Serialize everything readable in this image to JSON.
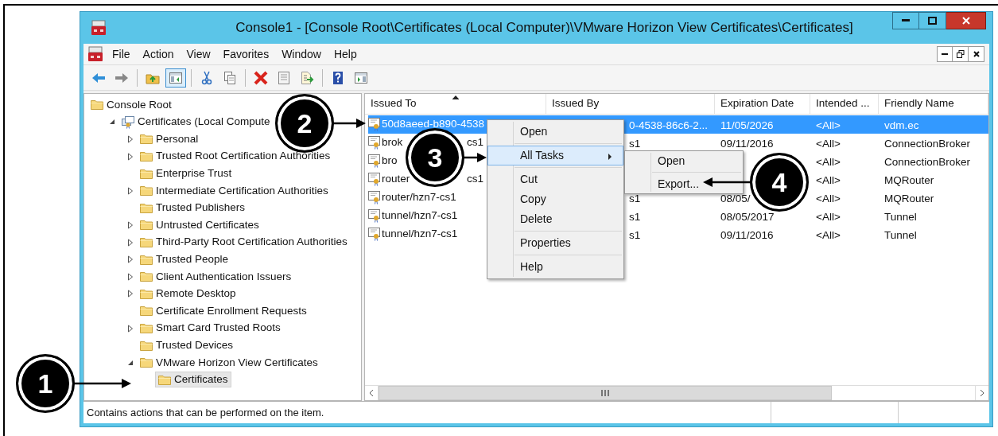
{
  "window": {
    "title": "Console1 - [Console Root\\Certificates (Local Computer)\\VMware Horizon View Certificates\\Certificates]"
  },
  "menu_bar": [
    "File",
    "Action",
    "View",
    "Favorites",
    "Window",
    "Help"
  ],
  "toolbar": [
    {
      "kind": "back",
      "selected": false
    },
    {
      "kind": "forward",
      "selected": false
    },
    {
      "kind": "folder-up",
      "selected": false
    },
    {
      "kind": "tree-toggle",
      "selected": true
    },
    {
      "kind": "cut",
      "selected": false
    },
    {
      "kind": "copy",
      "selected": false
    },
    {
      "kind": "delete",
      "selected": false
    },
    {
      "kind": "properties",
      "selected": false
    },
    {
      "kind": "export",
      "selected": false
    },
    {
      "kind": "help",
      "selected": false
    },
    {
      "kind": "action-pane",
      "selected": false
    }
  ],
  "tree": [
    {
      "label": "Console Root",
      "kind": "folder",
      "selected": false,
      "children": [
        {
          "label": "Certificates (Local Compute",
          "kind": "store",
          "expanded": true,
          "selected": false,
          "children": [
            {
              "label": "Personal",
              "kind": "folder",
              "expanded": false,
              "selected": false
            },
            {
              "label": "Trusted Root Certification Authorities",
              "kind": "folder",
              "expanded": false,
              "selected": false
            },
            {
              "label": "Enterprise Trust",
              "kind": "folder",
              "selected": false
            },
            {
              "label": "Intermediate Certification Authorities",
              "kind": "folder",
              "expanded": false,
              "selected": false
            },
            {
              "label": "Trusted Publishers",
              "kind": "folder",
              "selected": false
            },
            {
              "label": "Untrusted Certificates",
              "kind": "folder",
              "expanded": false,
              "selected": false
            },
            {
              "label": "Third-Party Root Certification Authorities",
              "kind": "folder",
              "expanded": false,
              "selected": false
            },
            {
              "label": "Trusted People",
              "kind": "folder",
              "expanded": false,
              "selected": false
            },
            {
              "label": "Client Authentication Issuers",
              "kind": "folder",
              "expanded": false,
              "selected": false
            },
            {
              "label": "Remote Desktop",
              "kind": "folder",
              "expanded": false,
              "selected": false
            },
            {
              "label": "Certificate Enrollment Requests",
              "kind": "folder",
              "selected": false
            },
            {
              "label": "Smart Card Trusted Roots",
              "kind": "folder",
              "expanded": false,
              "selected": false
            },
            {
              "label": "Trusted Devices",
              "kind": "folder",
              "selected": false
            },
            {
              "label": "VMware Horizon View Certificates",
              "kind": "folder",
              "expanded": true,
              "selected": false,
              "children": [
                {
                  "label": "Certificates",
                  "kind": "folder",
                  "selected": true
                }
              ]
            }
          ]
        }
      ]
    }
  ],
  "list": {
    "columns": [
      {
        "label": "Issued To",
        "sorted": true
      },
      {
        "label": "Issued By",
        "sorted": false
      },
      {
        "label": "Expiration Date",
        "sorted": false
      },
      {
        "label": "Intended ...",
        "sorted": false
      },
      {
        "label": "Friendly Name",
        "sorted": false
      }
    ],
    "rows": [
      {
        "selected": true,
        "issued_to": [
          "50d8aeed-b890-4538"
        ],
        "issued_by": "0-4538-86c6-2...",
        "expiration_date": "11/05/2026",
        "intended": "<All>",
        "friendly_name": "vdm.ec"
      },
      {
        "selected": false,
        "issued_to": [
          "brok",
          "cs1"
        ],
        "issued_by": "s1",
        "expiration_date": "09/11/2016",
        "intended": "<All>",
        "friendly_name": "ConnectionBroker"
      },
      {
        "selected": false,
        "issued_to": [
          "bro"
        ],
        "intended": "<All>",
        "friendly_name": "ConnectionBroker"
      },
      {
        "selected": false,
        "issued_to": [
          "router",
          "cs1"
        ],
        "intended": "<All>",
        "friendly_name": "MQRouter"
      },
      {
        "selected": false,
        "issued_to": [
          "router/hzn7-cs1"
        ],
        "issued_by": "s1",
        "expiration_date": "08/05/",
        "intended": "<All>",
        "friendly_name": "MQRouter"
      },
      {
        "selected": false,
        "issued_to": [
          "tunnel/hzn7-cs1"
        ],
        "issued_by": "s1",
        "expiration_date": "08/05/2017",
        "intended": "<All>",
        "friendly_name": "Tunnel"
      },
      {
        "selected": false,
        "issued_to": [
          "tunnel/hzn7-cs1"
        ],
        "issued_by": "s1",
        "expiration_date": "09/11/2016",
        "intended": "<All>",
        "friendly_name": "Tunnel"
      }
    ]
  },
  "context_menu": [
    {
      "label": "Open",
      "kind": "item",
      "separator_before": false,
      "selected": false
    },
    {
      "label": "All Tasks",
      "kind": "submenu",
      "separator_before": true,
      "selected": true
    },
    {
      "label": "Cut",
      "kind": "item",
      "separator_before": true,
      "selected": false
    },
    {
      "label": "Copy",
      "kind": "item",
      "separator_before": false,
      "selected": false
    },
    {
      "label": "Delete",
      "kind": "item",
      "separator_before": false,
      "selected": false
    },
    {
      "label": "Properties",
      "kind": "item",
      "separator_before": true,
      "selected": false
    },
    {
      "label": "Help",
      "kind": "item",
      "separator_before": true,
      "selected": false
    }
  ],
  "submenu": [
    {
      "label": "Open",
      "separator_before": false,
      "selected": false
    },
    {
      "label": "Export...",
      "separator_before": true,
      "selected": false
    }
  ],
  "status_bar": {
    "text": "Contains actions that can be performed on the item."
  },
  "callouts": [
    {
      "label": "1"
    },
    {
      "label": "2"
    },
    {
      "label": "3"
    },
    {
      "label": "4"
    }
  ]
}
